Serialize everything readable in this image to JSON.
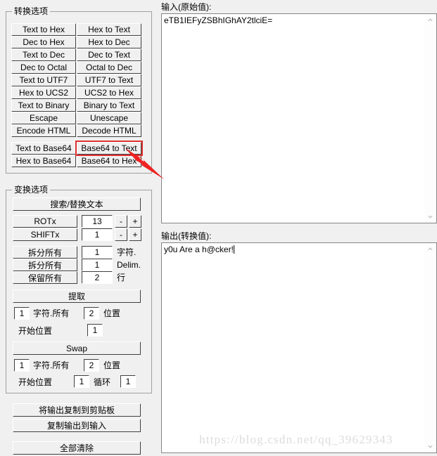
{
  "conversion_group": {
    "title": "转换选项",
    "buttons_left": [
      "Text to Hex",
      "Dec to Hex",
      "Text to Dec",
      "Dec to Octal",
      "Text to UTF7",
      "Hex to UCS2",
      "Text to Binary",
      "Escape",
      "Encode HTML"
    ],
    "buttons_right": [
      "Hex to Text",
      "Hex to Dec",
      "Dec to Text",
      "Octal to Dec",
      "UTF7 to Text",
      "UCS2 to Hex",
      "Binary to Text",
      "Unescape",
      "Decode HTML"
    ],
    "base64_left": [
      "Text to Base64",
      "Hex to Base64"
    ],
    "base64_right": [
      "Base64 to Text",
      "Base64 to Hex"
    ],
    "highlighted_button": "Base64 to Text",
    "highlight_color": "#e03030"
  },
  "transform_group": {
    "title": "变换选项",
    "search_replace_label": "搜索/替换文本",
    "rot": {
      "label": "ROTx",
      "value": "13",
      "minus": "-",
      "plus": "+"
    },
    "shift": {
      "label": "SHIFTx",
      "value": "1",
      "minus": "-",
      "plus": "+"
    },
    "split_rows": [
      {
        "button": "拆分所有",
        "value": "1",
        "unit": "字符."
      },
      {
        "button": "拆分所有",
        "value": "1",
        "unit": "Delim."
      },
      {
        "button": "保留所有",
        "value": "2",
        "unit": "行"
      }
    ],
    "extract": {
      "button": "提取",
      "count_value": "1",
      "count_label": "字符.所有",
      "pos_value": "2",
      "pos_label": "位置",
      "start_label": "开始位置",
      "start_value": "1"
    },
    "swap": {
      "button": "Swap",
      "count_value": "1",
      "count_label": "字符.所有",
      "pos_value": "2",
      "pos_label": "位置",
      "start_label": "开始位置",
      "start_value": "1",
      "loop_label": "循环",
      "loop_value": "1"
    }
  },
  "actions": {
    "copy_output_to_clipboard": "将输出复制到剪贴板",
    "copy_output_to_input": "复制输出到输入",
    "clear_all": "全部清除"
  },
  "input_area": {
    "label": "输入(原始值):",
    "value": "eTB1IEFyZSBhIGhAY2tlciE="
  },
  "output_area": {
    "label": "输出(转换值):",
    "value": "y0u Are a h@cker!"
  },
  "watermark": "https://blog.csdn.net/qq_39629343"
}
